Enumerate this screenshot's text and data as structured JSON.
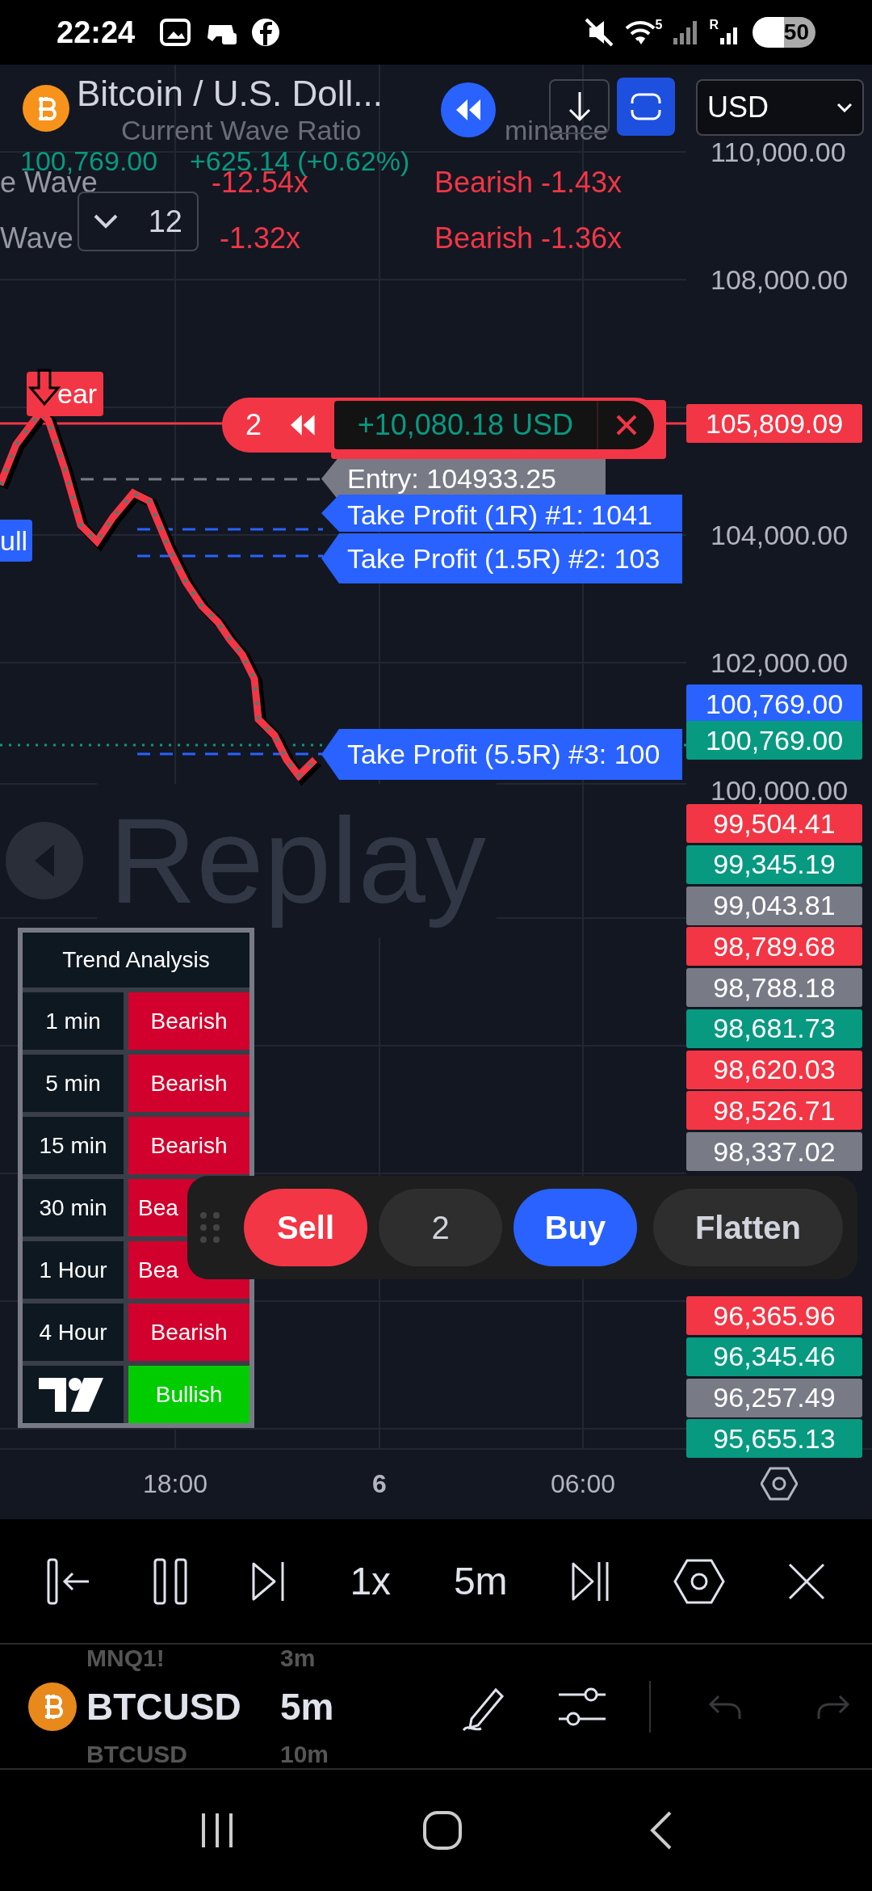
{
  "status_bar": {
    "time": "22:24",
    "wifi_label": "5",
    "signal_label": "R",
    "battery": "50"
  },
  "header": {
    "symbol_title": "Bitcoin / U.S. Doll...",
    "price": "100,769.00",
    "change": "+625.14 (+0.62%)",
    "currency": "USD"
  },
  "wave_table": {
    "columns": [
      "Current Wave Ratio",
      "minance"
    ],
    "collapse_count": "12",
    "rows": [
      {
        "label": "e Wave",
        "ratio": "-12.54x",
        "dominance": "Bearish -1.43x"
      },
      {
        "label": "Wave",
        "ratio": "-1.32x",
        "dominance": "Bearish -1.36x"
      }
    ]
  },
  "price_axis": {
    "ticks": [
      "110,000.00",
      "108,000.00",
      "104,000.00",
      "102,000.00",
      "100,000.00"
    ],
    "tags": [
      {
        "text": "105,809.09",
        "color": "#f23645"
      },
      {
        "text": "100,769.00",
        "color": "#2962ff"
      },
      {
        "text": "100,769.00",
        "color": "#089981"
      },
      {
        "text": "99,504.41",
        "color": "#f23645"
      },
      {
        "text": "99,345.19",
        "color": "#089981"
      },
      {
        "text": "99,043.81",
        "color": "#787b86"
      },
      {
        "text": "98,789.68",
        "color": "#f23645"
      },
      {
        "text": "98,788.18",
        "color": "#787b86"
      },
      {
        "text": "98,681.73",
        "color": "#089981"
      },
      {
        "text": "98,620.03",
        "color": "#f23645"
      },
      {
        "text": "98,526.71",
        "color": "#f23645"
      },
      {
        "text": "98,337.02",
        "color": "#787b86"
      },
      {
        "text": "96,365.96",
        "color": "#f23645"
      },
      {
        "text": "96,345.46",
        "color": "#089981"
      },
      {
        "text": "96,257.49",
        "color": "#787b86"
      },
      {
        "text": "95,655.13",
        "color": "#089981"
      }
    ]
  },
  "markers": [
    {
      "kind": "bear",
      "text": "ear"
    },
    {
      "kind": "bull",
      "text": "ull"
    }
  ],
  "position": {
    "quantity": "2",
    "pnl": "+10,080.18 USD"
  },
  "order_lines": [
    {
      "kind": "entry",
      "text": "Entry: 104933.25"
    },
    {
      "kind": "take_profit",
      "text": "Take Profit (1R) #1: 1041"
    },
    {
      "kind": "take_profit",
      "text": "Take Profit (1.5R) #2: 103"
    },
    {
      "kind": "take_profit",
      "text": "Take Profit (5.5R) #3: 100"
    }
  ],
  "replay_overlay_text": "Replay",
  "trend_analysis": {
    "title": "Trend Analysis",
    "rows": [
      {
        "timeframe": "1 min",
        "trend": "Bearish",
        "kind": "bearish"
      },
      {
        "timeframe": "5 min",
        "trend": "Bearish",
        "kind": "bearish"
      },
      {
        "timeframe": "15 min",
        "trend": "Bearish",
        "kind": "bearish"
      },
      {
        "timeframe": "30 min",
        "trend": "Bea",
        "kind": "bearish"
      },
      {
        "timeframe": "1 Hour",
        "trend": "Bea",
        "kind": "bearish"
      },
      {
        "timeframe": "4 Hour",
        "trend": "Bearish",
        "kind": "bearish"
      },
      {
        "timeframe": "",
        "trend": "Bullish",
        "kind": "bullish"
      }
    ]
  },
  "order_bar": {
    "sell": "Sell",
    "quantity": "2",
    "buy": "Buy",
    "flatten": "Flatten"
  },
  "time_axis": [
    {
      "label": "18:00",
      "kind": "time"
    },
    {
      "label": "6",
      "kind": "day"
    },
    {
      "label": "06:00",
      "kind": "time"
    }
  ],
  "replay_bar": {
    "speed": "1x",
    "interval": "5m"
  },
  "symbol_picker": [
    {
      "symbol": "MNQ1!",
      "interval": "3m",
      "selected": false
    },
    {
      "symbol": "BTCUSD",
      "interval": "5m",
      "selected": true
    },
    {
      "symbol": "BTCUSD",
      "interval": "10m",
      "selected": false
    }
  ],
  "history": {
    "undo_disabled": true,
    "redo_disabled": true
  }
}
